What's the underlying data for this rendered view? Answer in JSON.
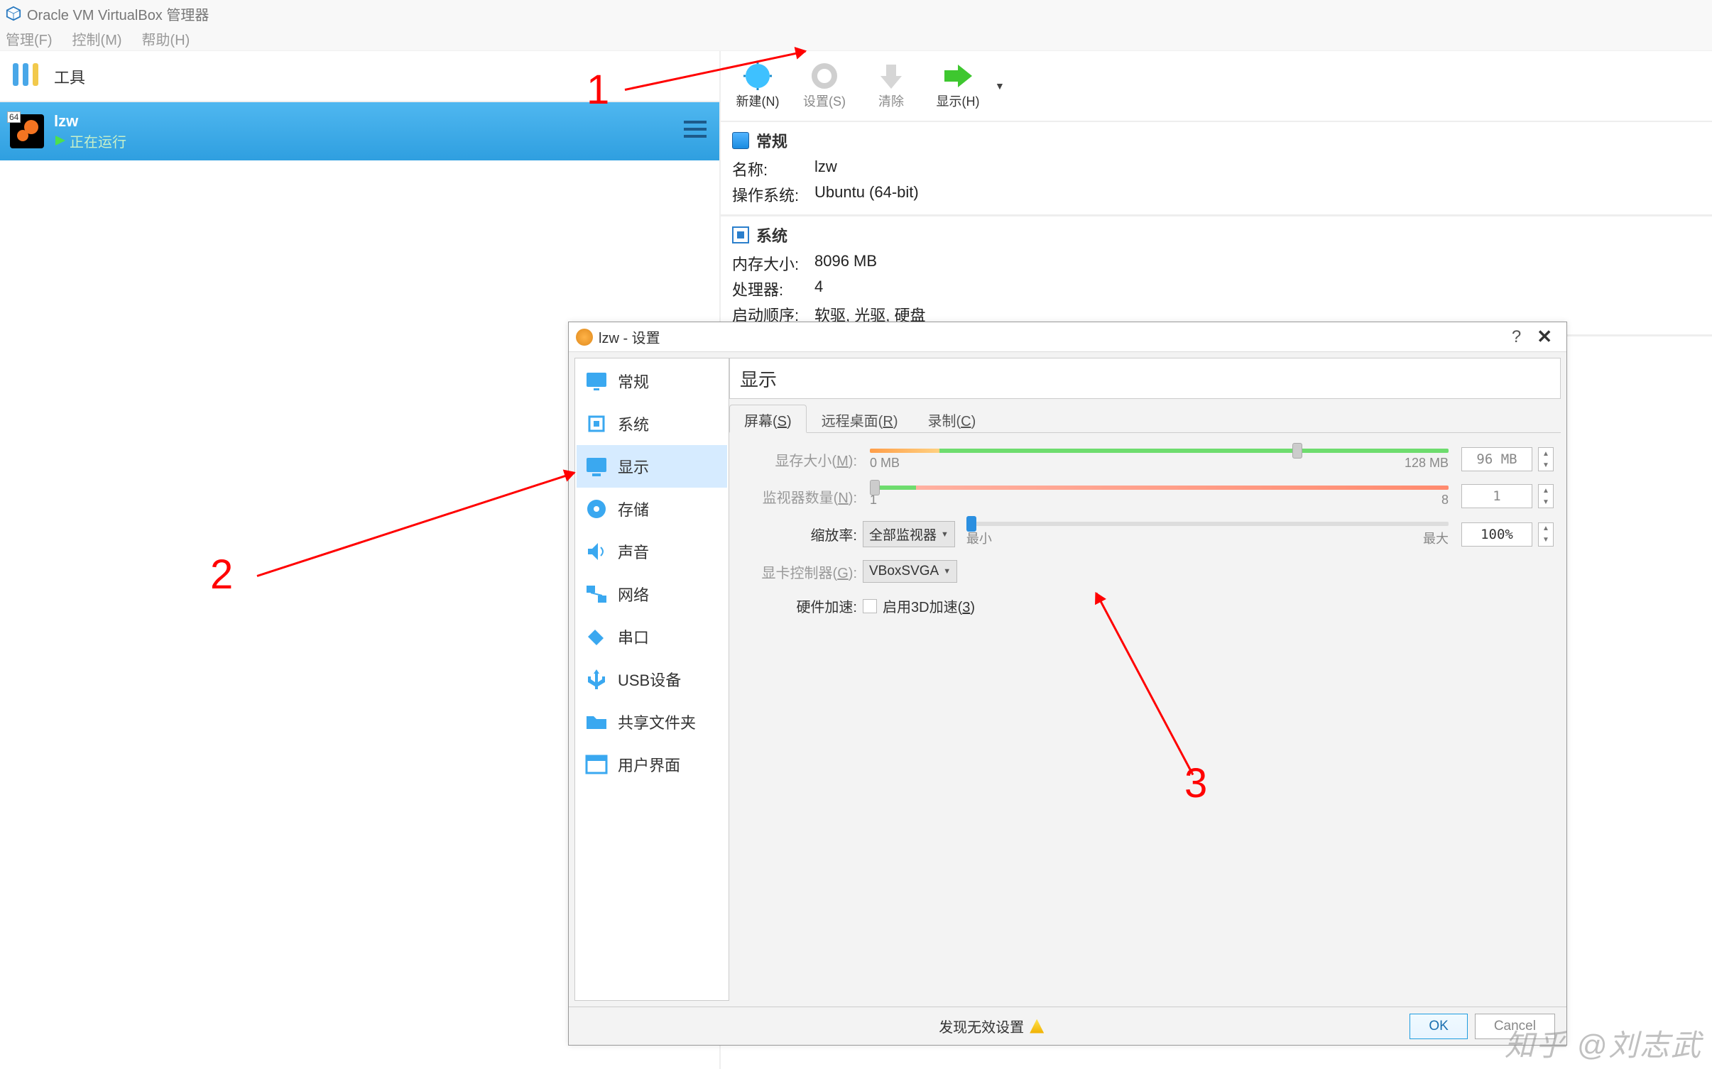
{
  "window": {
    "title": "Oracle VM VirtualBox 管理器"
  },
  "menubar": {
    "manage": "管理(F)",
    "control": "控制(M)",
    "help": "帮助(H)"
  },
  "left": {
    "tools": "工具",
    "vm_name": "lzw",
    "vm_state": "正在运行",
    "badge": "64"
  },
  "toolbar": {
    "new": "新建(N)",
    "settings": "设置(S)",
    "discard": "清除",
    "show": "显示(H)"
  },
  "details": {
    "general_title": "常规",
    "name_k": "名称:",
    "name_v": "lzw",
    "os_k": "操作系统:",
    "os_v": "Ubuntu (64-bit)",
    "system_title": "系统",
    "mem_k": "内存大小:",
    "mem_v": "8096 MB",
    "cpu_k": "处理器:",
    "cpu_v": "4",
    "boot_k": "启动顺序:",
    "boot_v": "软驱, 光驱, 硬盘"
  },
  "dialog": {
    "title": "lzw - 设置",
    "side": {
      "general": "常规",
      "system": "系统",
      "display": "显示",
      "storage": "存储",
      "audio": "声音",
      "network": "网络",
      "serial": "串口",
      "usb": "USB设备",
      "shared": "共享文件夹",
      "ui": "用户界面"
    },
    "heading": "显示",
    "tabs": {
      "screen": "屏幕(S)",
      "remote": "远程桌面(R)",
      "record": "录制(C)"
    },
    "form": {
      "vram_label": "显存大小(M):",
      "vram_min": "0 MB",
      "vram_max": "128 MB",
      "vram_val": "96 MB",
      "monitors_label": "监视器数量(N):",
      "monitors_min": "1",
      "monitors_max": "8",
      "monitors_val": "1",
      "scale_label": "缩放率:",
      "scale_sel": "全部监视器",
      "scale_min": "最小",
      "scale_max": "最大",
      "scale_val": "100%",
      "gpu_label": "显卡控制器(G):",
      "gpu_sel": "VBoxSVGA",
      "accel_label": "硬件加速:",
      "accel_chk": "启用3D加速(3)"
    },
    "footer": {
      "warn": "发现无效设置",
      "ok": "OK",
      "cancel": "Cancel"
    }
  },
  "annotations": {
    "n1": "1",
    "n2": "2",
    "n3": "3"
  },
  "watermark": "知乎  @刘志武"
}
